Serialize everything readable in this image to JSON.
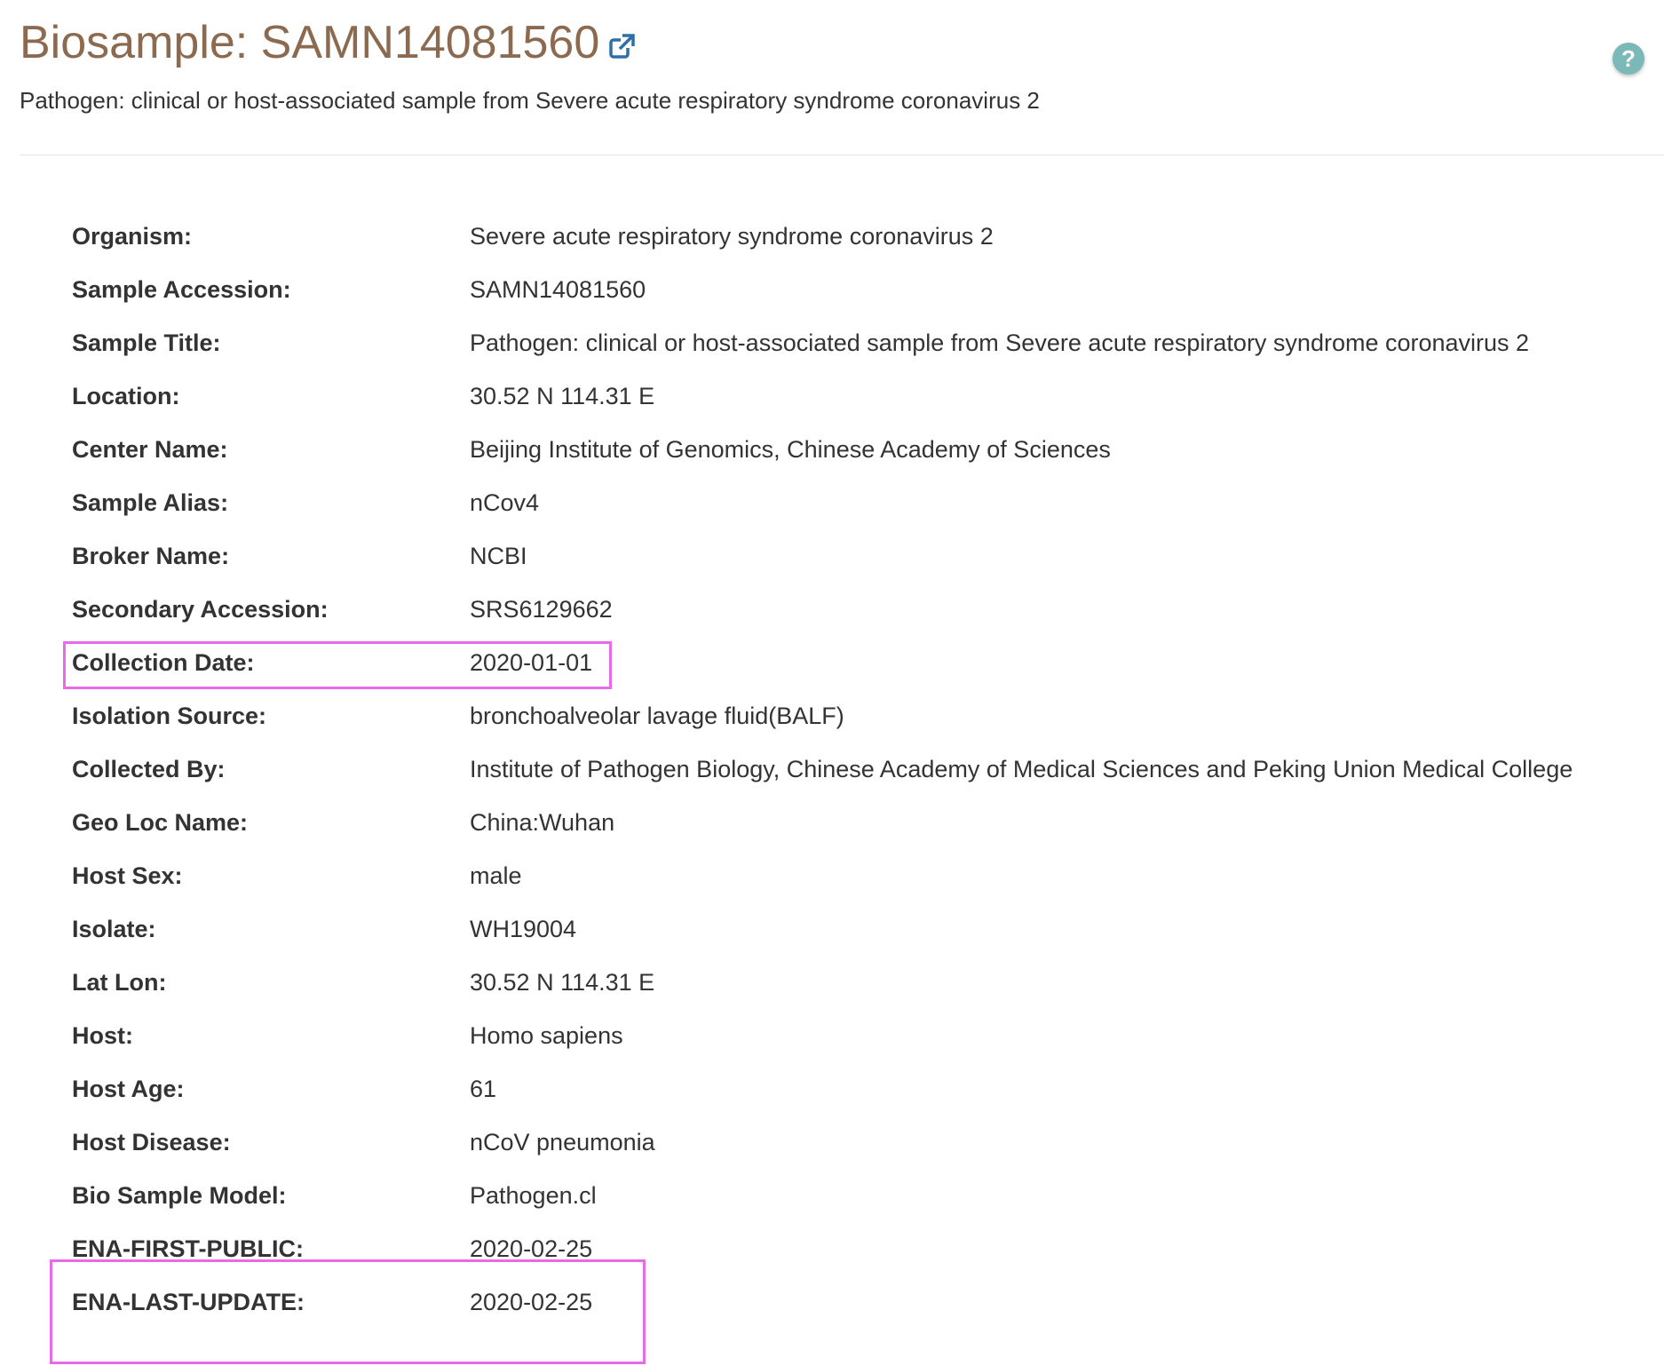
{
  "header": {
    "title": "Biosample: SAMN14081560",
    "external_link_icon": "external-link-icon",
    "subtitle": "Pathogen: clinical or host-associated sample from Severe acute respiratory syndrome coronavirus 2",
    "help_label": "?",
    "help_icon": "help-icon"
  },
  "colors": {
    "title": "#8c6a4f",
    "link": "#2f6fa8",
    "help": "#7bb8b8",
    "highlight": "#e86ae8"
  },
  "attributes": [
    {
      "label": "Organism:",
      "value": "Severe acute respiratory syndrome coronavirus 2"
    },
    {
      "label": "Sample Accession:",
      "value": "SAMN14081560"
    },
    {
      "label": "Sample Title:",
      "value": "Pathogen: clinical or host-associated sample from Severe acute respiratory syndrome coronavirus 2"
    },
    {
      "label": "Location:",
      "value": "30.52 N 114.31 E"
    },
    {
      "label": "Center Name:",
      "value": "Beijing Institute of Genomics, Chinese Academy of Sciences"
    },
    {
      "label": "Sample Alias:",
      "value": "nCov4"
    },
    {
      "label": "Broker Name:",
      "value": "NCBI"
    },
    {
      "label": "Secondary Accession:",
      "value": "SRS6129662"
    },
    {
      "label": "Collection Date:",
      "value": "2020-01-01"
    },
    {
      "label": "Isolation Source:",
      "value": "bronchoalveolar lavage fluid(BALF)"
    },
    {
      "label": "Collected By:",
      "value": "Institute of Pathogen Biology, Chinese Academy of Medical Sciences and Peking Union Medical College"
    },
    {
      "label": "Geo Loc Name:",
      "value": "China:Wuhan"
    },
    {
      "label": "Host Sex:",
      "value": "male"
    },
    {
      "label": "Isolate:",
      "value": "WH19004"
    },
    {
      "label": "Lat Lon:",
      "value": "30.52 N 114.31 E"
    },
    {
      "label": "Host:",
      "value": "Homo sapiens"
    },
    {
      "label": "Host Age:",
      "value": "61"
    },
    {
      "label": "Host Disease:",
      "value": "nCoV pneumonia"
    },
    {
      "label": "Bio Sample Model:",
      "value": "Pathogen.cl"
    },
    {
      "label": "ENA-FIRST-PUBLIC:",
      "value": "2020-02-25"
    },
    {
      "label": "ENA-LAST-UPDATE:",
      "value": "2020-02-25"
    }
  ]
}
